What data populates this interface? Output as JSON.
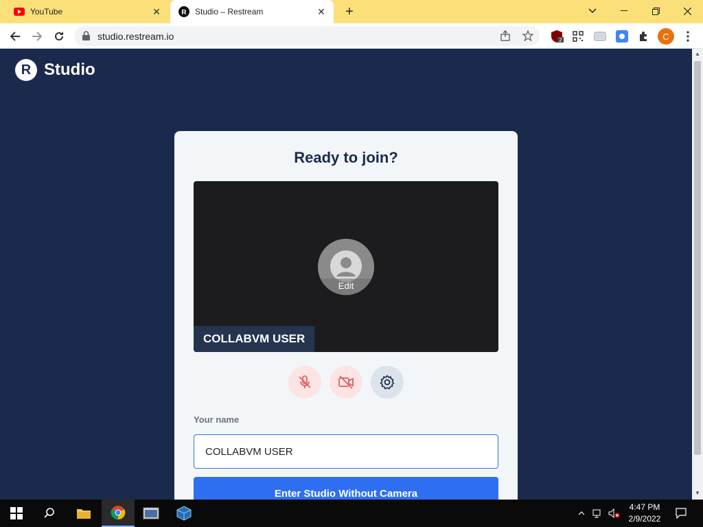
{
  "browser": {
    "tabs": [
      {
        "title": "YouTube",
        "favicon": "youtube-icon"
      },
      {
        "title": "Studio – Restream",
        "favicon": "restream-icon"
      }
    ],
    "url": "studio.restream.io",
    "profile_initial": "C",
    "ext_badge": "2"
  },
  "page": {
    "brand_letter": "R",
    "brand_name": "Studio",
    "heading": "Ready to join?",
    "avatar_edit": "Edit",
    "name_tag": "COLLABVM USER",
    "name_label": "Your name",
    "name_value": "COLLABVM USER",
    "enter_button": "Enter Studio Without Camera"
  },
  "taskbar": {
    "time": "4:47 PM",
    "date": "2/9/2022"
  },
  "colors": {
    "accent": "#2e6ff2",
    "page_bg": "#1b2a4c",
    "tab_strip": "#fbe07a",
    "muted_red": "#e25c5c"
  }
}
